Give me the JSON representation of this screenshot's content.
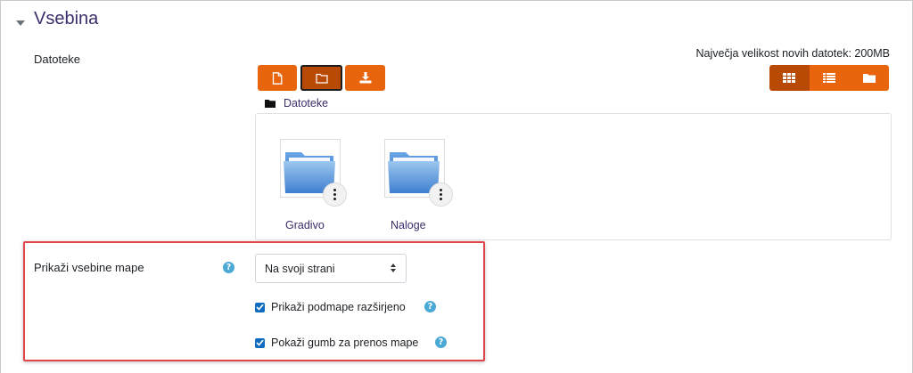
{
  "section": {
    "title": "Vsebina"
  },
  "files_field": {
    "label": "Datoteke",
    "max_size_text": "Največja velikost novih datotek: 200MB",
    "toolbar": {
      "add_file": "file-icon",
      "create_folder": "folder-outline-icon",
      "download_all": "download-icon"
    },
    "views": [
      {
        "name": "grid-view-icon",
        "active": true
      },
      {
        "name": "list-view-icon",
        "active": false
      },
      {
        "name": "tree-view-icon",
        "active": false
      }
    ],
    "path": {
      "label": "Datoteke"
    },
    "items": [
      {
        "name": "Gradivo",
        "type": "folder"
      },
      {
        "name": "Naloge",
        "type": "folder"
      }
    ]
  },
  "display": {
    "label": "Prikaži vsebine mape",
    "help_glyph": "?",
    "selected": "Na svoji strani"
  },
  "options": [
    {
      "label": "Prikaži podmape razširjeno",
      "checked": true,
      "help_glyph": "?"
    },
    {
      "label": "Pokaži gumb za prenos mape",
      "checked": true,
      "help_glyph": "?"
    }
  ],
  "colors": {
    "accent": "#e8650e",
    "accent_dark": "#b94a05",
    "link": "#3e2d6b",
    "checkbox": "#0f6cbf",
    "help": "#4ba9d6",
    "highlight": "#e0454b"
  }
}
